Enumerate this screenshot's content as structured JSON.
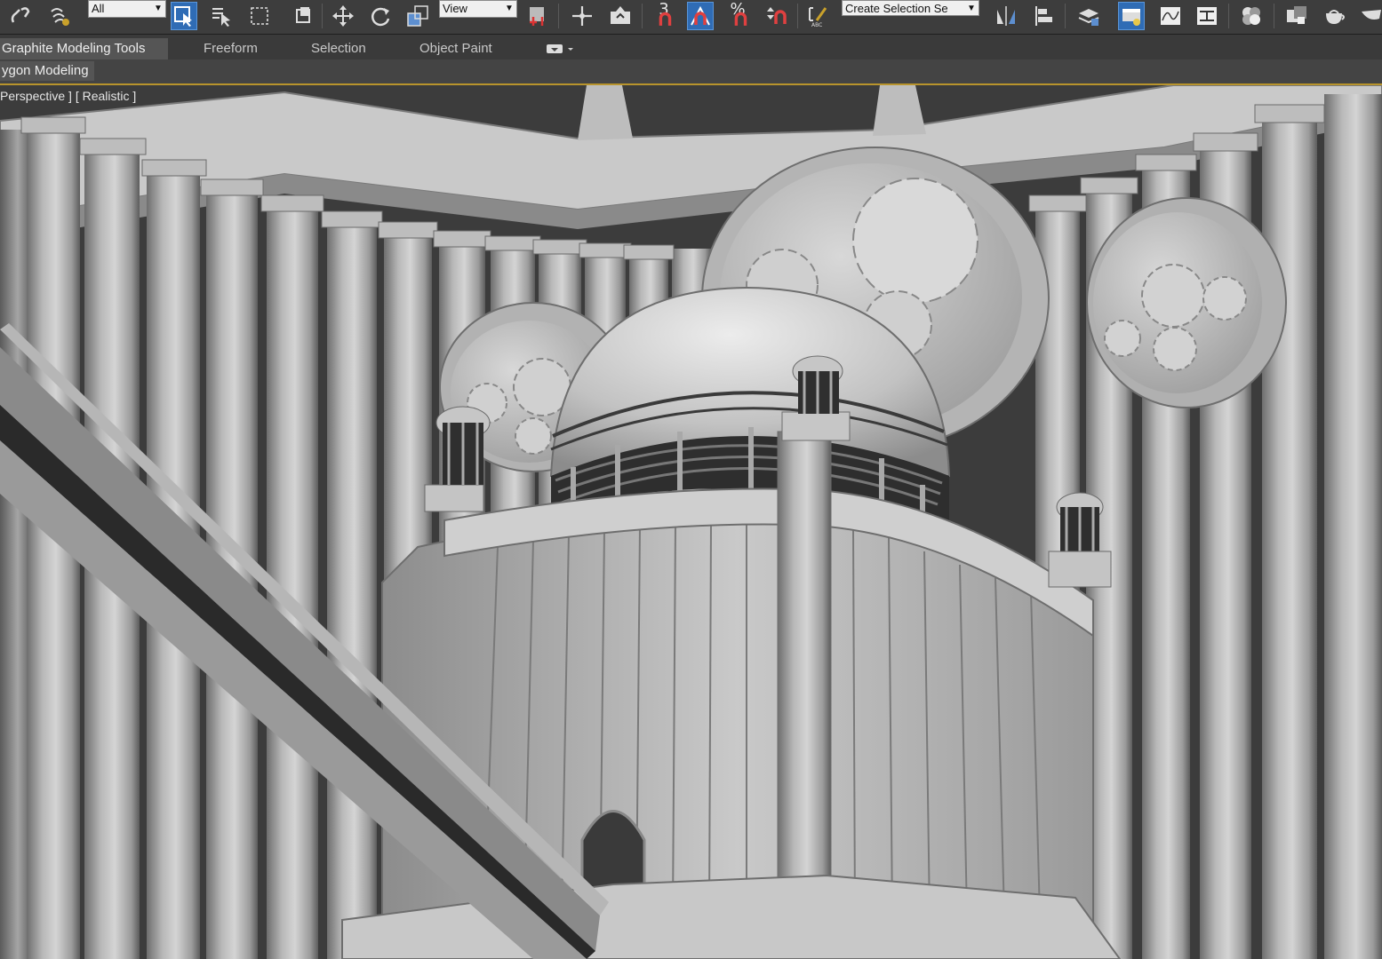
{
  "toolbar": {
    "selection_filter": "All",
    "reference_coordinate": "View",
    "named_selection": "Create Selection Se",
    "snap_label": "3",
    "percent_snap_label": "%"
  },
  "ribbon": {
    "tabs": [
      "Graphite Modeling Tools",
      "Freeform",
      "Selection",
      "Object Paint"
    ],
    "panel_tab": "ygon Modeling"
  },
  "viewport": {
    "label": "Perspective ] [ Realistic ]"
  },
  "colors": {
    "active_button": "#2f6cb5",
    "viewport_border": "#b8942c",
    "toolbar_bg": "#3d3d3d"
  }
}
